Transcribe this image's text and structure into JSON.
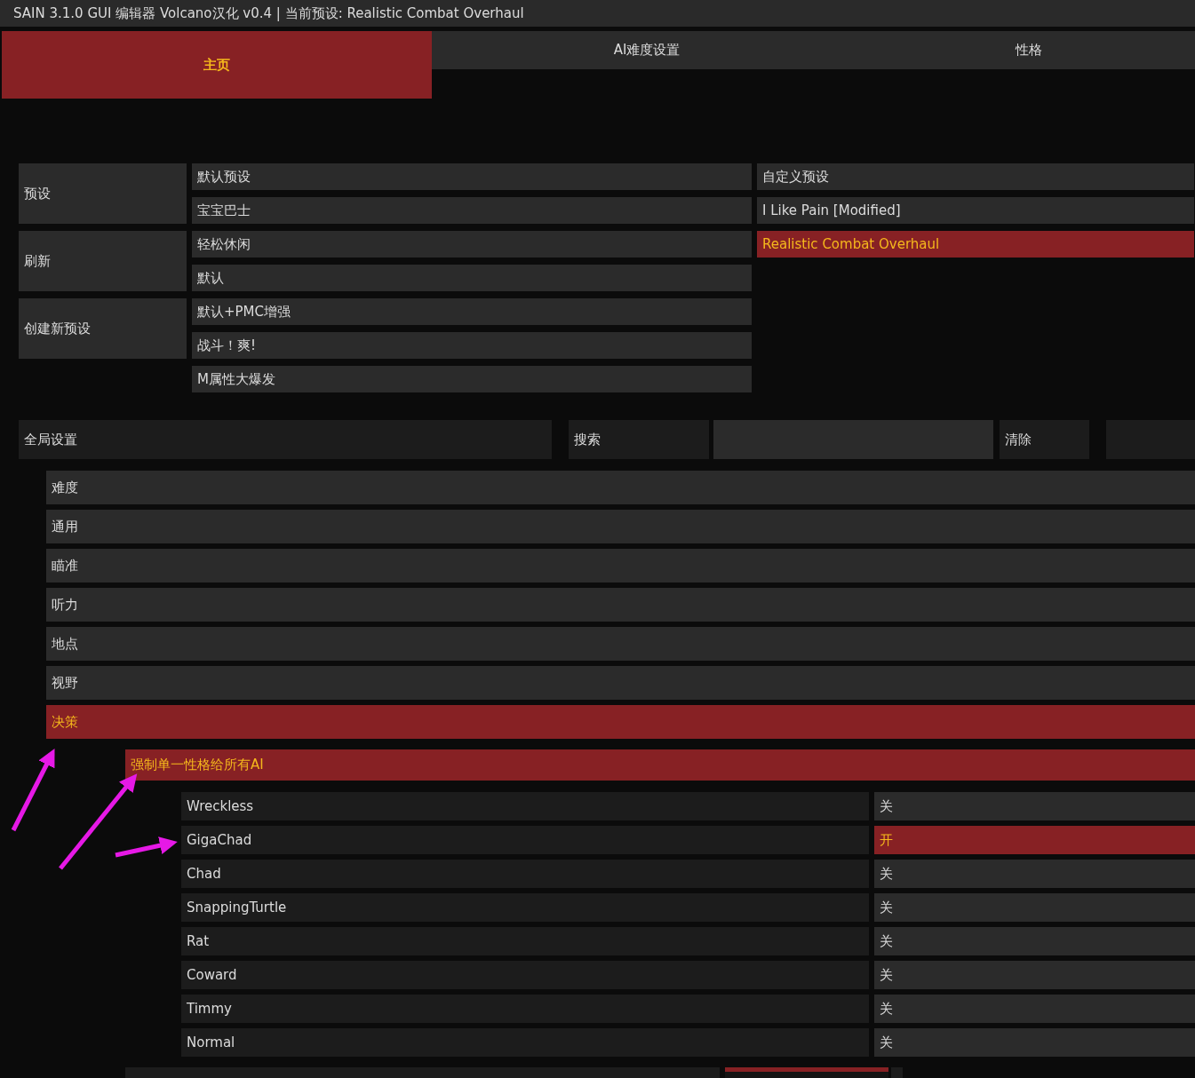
{
  "window": {
    "title": "SAIN 3.1.0 GUI 编辑器  Volcano汉化 v0.4 | 当前预设: Realistic Combat Overhaul"
  },
  "tabs": [
    {
      "label": "主页",
      "selected": true
    },
    {
      "label": "AI难度设置",
      "selected": false
    },
    {
      "label": "性格",
      "selected": false
    }
  ],
  "preset_actions": [
    {
      "label": "预设"
    },
    {
      "label": "刷新"
    },
    {
      "label": "创建新预设"
    }
  ],
  "default_presets": [
    {
      "label": "默认预设",
      "selected": false
    },
    {
      "label": "宝宝巴士",
      "selected": false
    },
    {
      "label": "轻松休闲",
      "selected": false
    },
    {
      "label": "默认",
      "selected": false
    },
    {
      "label": "默认+PMC增强",
      "selected": false
    },
    {
      "label": "战斗！爽!",
      "selected": false
    },
    {
      "label": "M属性大爆发",
      "selected": false
    }
  ],
  "custom_presets": {
    "heading": "自定义预设",
    "items": [
      {
        "label": "I Like Pain [Modified]",
        "selected": false
      },
      {
        "label": "Realistic Combat Overhaul",
        "selected": true
      }
    ]
  },
  "global_settings": {
    "label": "全局设置"
  },
  "search": {
    "label": "搜索",
    "clear": "清除"
  },
  "categories": [
    {
      "label": "难度",
      "selected": false
    },
    {
      "label": "通用",
      "selected": false
    },
    {
      "label": "瞄准",
      "selected": false
    },
    {
      "label": "听力",
      "selected": false
    },
    {
      "label": "地点",
      "selected": false
    },
    {
      "label": "视野",
      "selected": false
    },
    {
      "label": "决策",
      "selected": true
    }
  ],
  "subsection": {
    "label": "强制单一性格给所有AI",
    "selected": true
  },
  "personalities": [
    {
      "name": "Wreckless",
      "value": "关",
      "on": false
    },
    {
      "name": "GigaChad",
      "value": "开",
      "on": true
    },
    {
      "name": "Chad",
      "value": "关",
      "on": false
    },
    {
      "name": "SnappingTurtle",
      "value": "关",
      "on": false
    },
    {
      "name": "Rat",
      "value": "关",
      "on": false
    },
    {
      "name": "Coward",
      "value": "关",
      "on": false
    },
    {
      "name": "Timmy",
      "value": "关",
      "on": false
    },
    {
      "name": "Normal",
      "value": "关",
      "on": false
    }
  ]
}
